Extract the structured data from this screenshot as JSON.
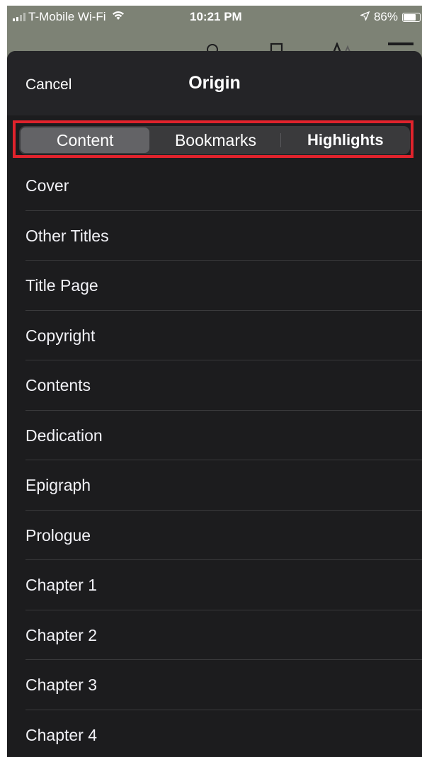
{
  "status_bar": {
    "carrier": "T-Mobile Wi-Fi",
    "time": "10:21 PM",
    "battery": "86%",
    "battery_level": 0.86
  },
  "sheet": {
    "cancel_label": "Cancel",
    "title": "Origin"
  },
  "tabs": [
    {
      "label": "Content",
      "selected": true
    },
    {
      "label": "Bookmarks",
      "selected": false
    },
    {
      "label": "Highlights",
      "selected": false
    }
  ],
  "toc": [
    {
      "label": "Cover"
    },
    {
      "label": "Other Titles"
    },
    {
      "label": "Title Page"
    },
    {
      "label": "Copyright"
    },
    {
      "label": "Contents"
    },
    {
      "label": "Dedication"
    },
    {
      "label": "Epigraph"
    },
    {
      "label": "Prologue"
    },
    {
      "label": "Chapter 1"
    },
    {
      "label": "Chapter 2"
    },
    {
      "label": "Chapter 3"
    },
    {
      "label": "Chapter 4"
    }
  ],
  "colors": {
    "highlight_box": "#e0232c",
    "sheet_background": "#1c1c1e",
    "segment_active": "#636366"
  }
}
